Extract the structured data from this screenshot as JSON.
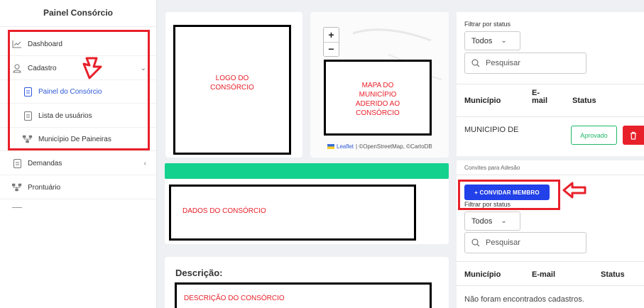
{
  "sidebar": {
    "title": "Painel Consórcio",
    "items": [
      {
        "label": "Dashboard",
        "icon": "chart-line-icon"
      },
      {
        "label": "Cadastro",
        "icon": "user-icon"
      },
      {
        "label": "Painel do Consórcio",
        "icon": "document-icon"
      },
      {
        "label": "Lista de usuários",
        "icon": "document-icon"
      },
      {
        "label": "Município De Paineiras",
        "icon": "org-chart-icon"
      },
      {
        "label": "Demandas",
        "icon": "document-icon"
      },
      {
        "label": "Prontuário",
        "icon": "org-chart-icon"
      }
    ]
  },
  "main": {
    "logo_text": "LOGO DO\nCONSÓRCIO",
    "map_text": "MAPA DO\nMUNICÍPIO\nADERIDO AO\nCONSÓRCIO",
    "zoom_in": "+",
    "zoom_out": "−",
    "map_attr_leaflet": "Leaflet",
    "map_attr_rest": " | ©OpenStreetMap, ©CartoDB",
    "dados_text": "DADOS DO CONSÓRCIO",
    "descricao_label": "Descrição:",
    "descricao_text": "DESCRIÇÃO DO CONSÓRCIO"
  },
  "members": {
    "filter_label": "Filtrar por status",
    "filter_value": "Todos",
    "search_placeholder": "Pesquisar",
    "col_municipio": "Município",
    "col_email": "E-\nmail",
    "col_status": "Status",
    "row_municipio": "MUNICIPIO DE",
    "row_status": "Aprovado"
  },
  "invites": {
    "section_title": "Convites para Adesão",
    "invite_button": "+ CONVIDAR MEMBRO",
    "filter_label": "Filtrar por status",
    "filter_value": "Todos",
    "search_placeholder": "Pesquisar",
    "col_municipio": "Município",
    "col_email": "E-mail",
    "col_status": "Status",
    "empty_message": "Não foram encontrados cadastros."
  },
  "colors": {
    "accent": "#2d58d8",
    "highlight": "#e8202a",
    "green": "#14d18e"
  }
}
